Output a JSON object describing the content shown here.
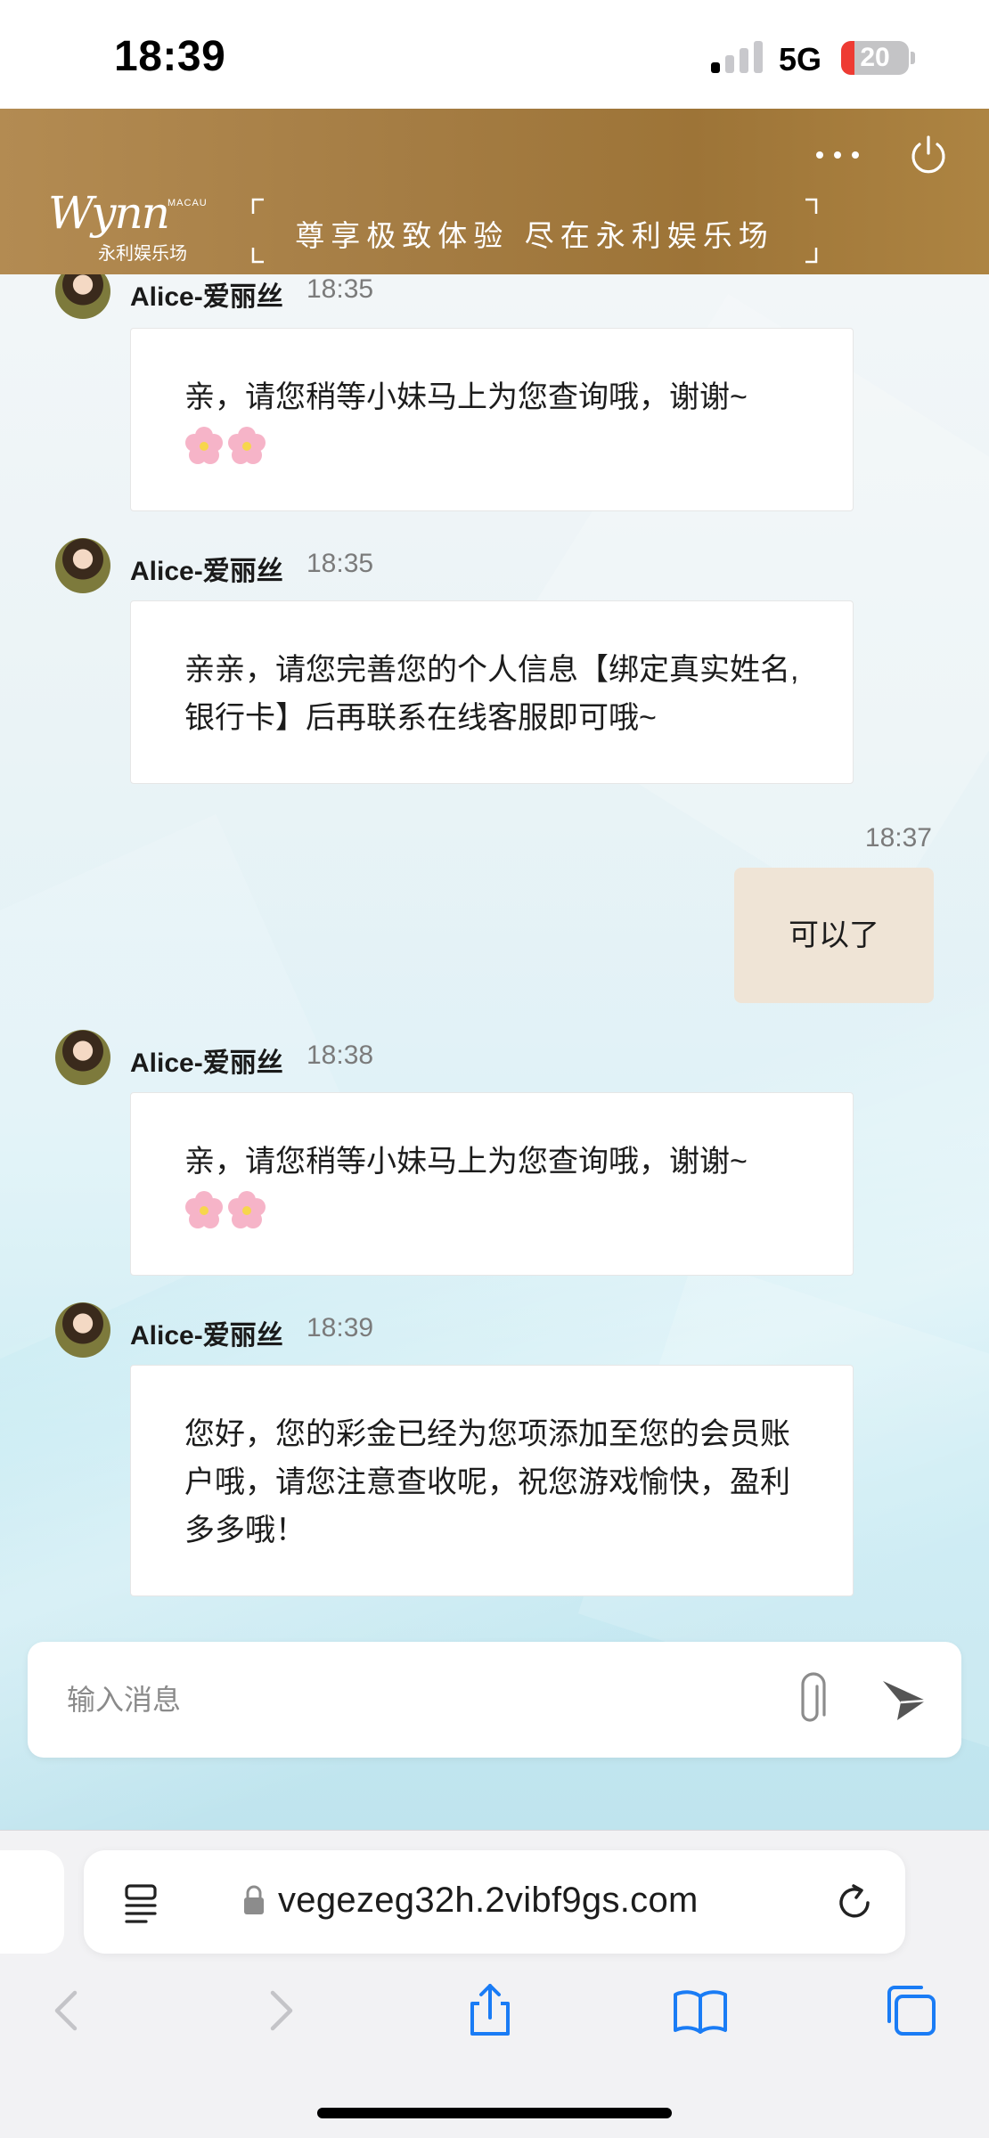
{
  "status_bar": {
    "time": "18:39",
    "network": "5G",
    "battery": "20",
    "battery_level": 0.2,
    "signal_bars": 1
  },
  "header": {
    "logo_text": "Wynn",
    "logo_sub": "MACAU",
    "logo_cn": "永利娱乐场",
    "banner": "尊享极致体验 尽在永利娱乐场",
    "icons": [
      "more-icon",
      "power-icon"
    ]
  },
  "messages": [
    {
      "from": "agent",
      "sender": "Alice-爱丽丝",
      "time": "18:35",
      "text": "亲，请您稍等小妹马上为您查询哦，谢谢~",
      "emoji": "🌸🌸"
    },
    {
      "from": "agent",
      "sender": "Alice-爱丽丝",
      "time": "18:35",
      "text": "亲亲，请您完善您的个人信息【绑定真实姓名,银行卡】后再联系在线客服即可哦~"
    },
    {
      "from": "user",
      "time": "18:37",
      "text": "可以了"
    },
    {
      "from": "agent",
      "sender": "Alice-爱丽丝",
      "time": "18:38",
      "text": "亲，请您稍等小妹马上为您查询哦，谢谢~",
      "emoji": "🌸🌸"
    },
    {
      "from": "agent",
      "sender": "Alice-爱丽丝",
      "time": "18:39",
      "text": "您好，您的彩金已经为您项添加至您的会员账户哦，请您注意查收呢，祝您游戏愉快，盈利多多哦！"
    }
  ],
  "composer": {
    "placeholder": "输入消息",
    "icons": [
      "paperclip-icon",
      "send-icon"
    ]
  },
  "browser": {
    "url": "vegezeg32h.2vibf9gs.com",
    "icons": [
      "reader-icon",
      "lock-icon",
      "reload-icon",
      "back-icon",
      "forward-icon",
      "share-icon",
      "bookmarks-icon",
      "tabs-icon"
    ]
  },
  "colors": {
    "header_gold": "#a57d44",
    "user_bubble": "#efe4d6",
    "agent_bubble": "#ffffff",
    "ios_blue": "#1a7cf5",
    "battery_red": "#ee3b33"
  }
}
